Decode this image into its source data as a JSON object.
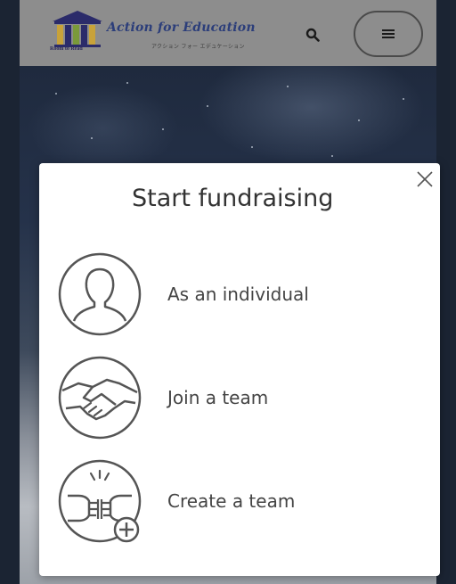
{
  "header": {
    "brand_title": "Action for Education",
    "brand_subtitle": "アクション フォー エデュケーション",
    "logo_caption": "Room to Read",
    "search_icon": "search-icon",
    "menu_icon": "hamburger-menu-icon"
  },
  "modal": {
    "title": "Start fundraising",
    "close_icon": "close-icon",
    "options": [
      {
        "label": "As an individual",
        "icon": "person-icon"
      },
      {
        "label": "Join a team",
        "icon": "handshake-icon"
      },
      {
        "label": "Create a team",
        "icon": "fist-bump-plus-icon"
      }
    ]
  },
  "colors": {
    "header_bg": "#8d8d8d",
    "brand_blue": "#2c3e7a",
    "modal_bg": "#ffffff",
    "icon_stroke": "#555555"
  }
}
